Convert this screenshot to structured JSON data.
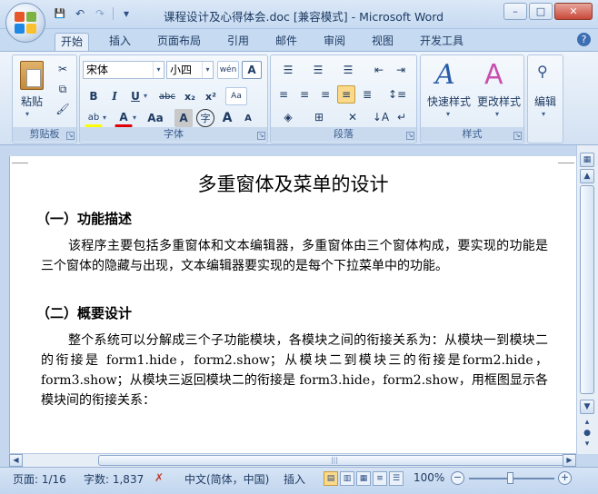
{
  "window": {
    "title": "课程设计及心得体会.doc [兼容模式] - Microsoft Word",
    "controls": {
      "minimize": "–",
      "maximize": "□",
      "close": "✕"
    }
  },
  "quick_access": {
    "save": "💾",
    "undo": "↶",
    "redo": "↷",
    "more": "▾"
  },
  "tabs": [
    {
      "label": "开始"
    },
    {
      "label": "插入"
    },
    {
      "label": "页面布局"
    },
    {
      "label": "引用"
    },
    {
      "label": "邮件"
    },
    {
      "label": "审阅"
    },
    {
      "label": "视图"
    },
    {
      "label": "开发工具"
    }
  ],
  "help": "?",
  "ribbon": {
    "clipboard": {
      "group_label": "剪贴板",
      "paste": "粘贴"
    },
    "font": {
      "group_label": "字体",
      "font_name": "宋体",
      "font_size": "小四",
      "phonetic": "wén",
      "charborder": "A",
      "bold": "B",
      "italic": "I",
      "underline": "U",
      "strike": "abc",
      "subscript": "x₂",
      "superscript": "x²",
      "clear": "Aa",
      "highlight": "ab",
      "color": "A",
      "changecase": "Aa",
      "shading": "A",
      "enclose": "字",
      "grow": "A",
      "shrink": "A"
    },
    "paragraph": {
      "group_label": "段落"
    },
    "styles": {
      "group_label": "样式",
      "quick_styles": "快速样式",
      "change_styles": "更改样式"
    },
    "editing": {
      "label": "编辑"
    }
  },
  "document": {
    "title": "多重窗体及菜单的设计",
    "sections": [
      {
        "heading": "（一）功能描述",
        "paragraph": "该程序主要包括多重窗体和文本编辑器，多重窗体由三个窗体构成，要实现的功能是三个窗体的隐藏与出现，文本编辑器要实现的是每个下拉菜单中的功能。"
      },
      {
        "heading": "（二）概要设计",
        "paragraph": "整个系统可以分解成三个子功能模块，各模块之间的衔接关系为：从模块一到模块二的衔接是 form1.hide，form2.show；从模块二到模块三的衔接是form2.hide，form3.show；从模块三返回模块二的衔接是 form3.hide，form2.show，用框图显示各模块间的衔接关系："
      }
    ]
  },
  "statusbar": {
    "page": "页面: 1/16",
    "words": "字数: 1,837",
    "language": "中文(简体，中国)",
    "mode": "插入",
    "zoom": "100%",
    "zoom_minus": "−",
    "zoom_plus": "+"
  },
  "colors": {
    "highlight": "#ffff00",
    "font_color": "#e00000",
    "accent": "#3d6db3"
  }
}
